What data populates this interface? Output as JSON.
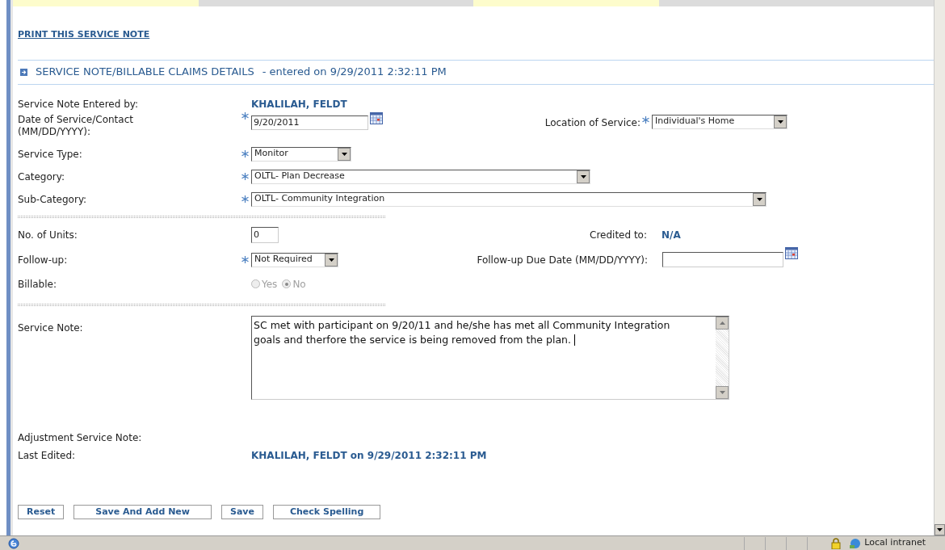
{
  "print_link": "PRINT THIS SERVICE NOTE",
  "section": {
    "title": "SERVICE NOTE/BILLABLE CLAIMS DETAILS",
    "subtitle": "- entered on 9/29/2011 2:32:11 PM",
    "expanded": true
  },
  "entered_by": {
    "label": "Service Note Entered by:",
    "value": "KHALILAH, FELDT"
  },
  "date": {
    "label": "Date of Service/Contact (MM/DD/YYYY):",
    "value": "9/20/2011",
    "required": true
  },
  "location": {
    "label": "Location of Service:",
    "value": "Individual's Home",
    "required": true
  },
  "service_type": {
    "label": "Service Type:",
    "value": "Monitor",
    "required": true
  },
  "category": {
    "label": "Category:",
    "value": "OLTL- Plan Decrease",
    "required": true
  },
  "sub_category": {
    "label": "Sub-Category:",
    "value": "OLTL- Community Integration",
    "required": true
  },
  "units": {
    "label": "No. of Units:",
    "value": "0"
  },
  "credited": {
    "label": "Credited to:",
    "value": "N/A"
  },
  "follow_up": {
    "label": "Follow-up:",
    "value": "Not Required",
    "required": true
  },
  "due_date": {
    "label": "Follow-up Due Date (MM/DD/YYYY):"
  },
  "billable": {
    "label": "Billable:",
    "disabled": true,
    "options": [
      {
        "label": "Yes",
        "selected": false
      },
      {
        "label": "No",
        "selected": true
      }
    ]
  },
  "service_note": {
    "label": "Service Note:",
    "value": "SC met with participant on 9/20/11 and he/she has met all Community Integration goals and therfore the service is being removed from the plan. "
  },
  "adjustment": {
    "label": "Adjustment Service Note:"
  },
  "last_edited": {
    "label": "Last Edited:",
    "value": "KHALILAH, FELDT on 9/29/2011 2:32:11 PM"
  },
  "buttons": [
    "Reset",
    "Save And Add New",
    "Save",
    "Check Spelling"
  ],
  "status_bar": {
    "zone": "Local intranet"
  }
}
